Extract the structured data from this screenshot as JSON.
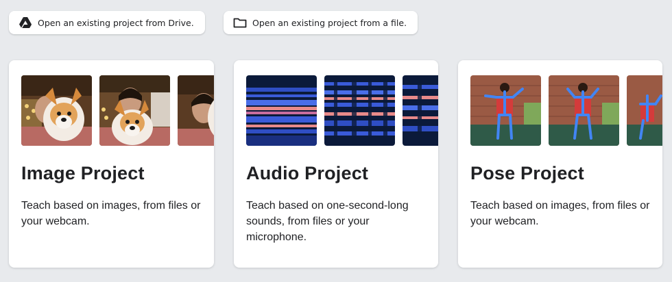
{
  "buttons": {
    "drive": {
      "label": "Open an existing project from Drive.",
      "icon": "google-drive-icon"
    },
    "file": {
      "label": "Open an existing project from a file.",
      "icon": "folder-icon"
    }
  },
  "cards": [
    {
      "title": "Image Project",
      "description": "Teach based on images, from files or your webcam."
    },
    {
      "title": "Audio Project",
      "description": "Teach based on one-second-long sounds, from files or your microphone."
    },
    {
      "title": "Pose Project",
      "description": "Teach based on images, from files or your webcam."
    }
  ],
  "colors": {
    "page_background": "#e8eaed",
    "card_background": "#ffffff",
    "text": "#202124",
    "spectrogram_dark": "#0b1a3a",
    "spectrogram_blue": "#3a5bd9",
    "spectrogram_warm": "#e88a8a",
    "pose_skeleton": "#4285f4"
  }
}
